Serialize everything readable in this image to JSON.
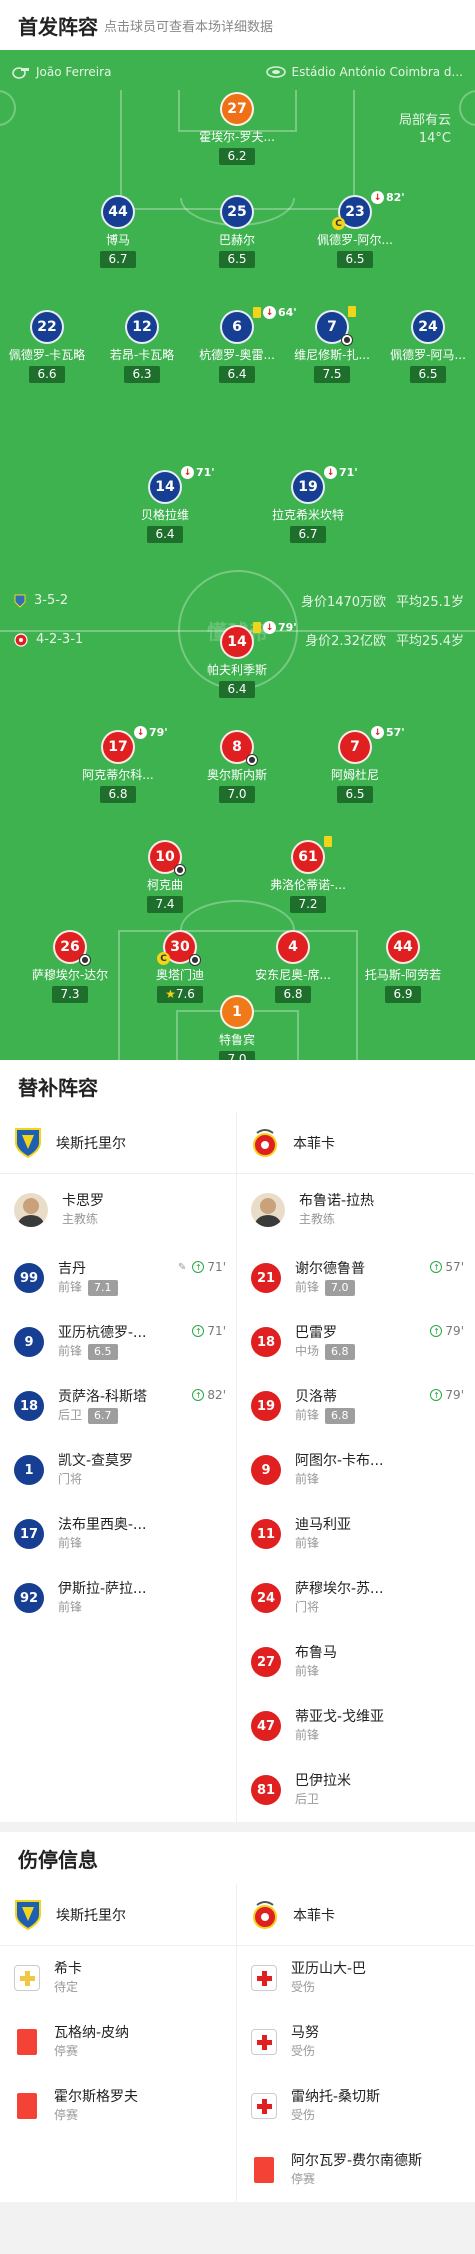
{
  "lineup_header": {
    "title": "首发阵容",
    "subtitle": "点击球员可查看本场详细数据"
  },
  "pitch": {
    "referee": "João Ferreira",
    "stadium": "Estádio António Coimbra d...",
    "weather": "局部有云",
    "temperature": "14°C",
    "watermark": "懂球帝",
    "away": {
      "formation": "3-5-2",
      "value": "身价1470万欧",
      "age": "平均25.1岁"
    },
    "home": {
      "formation": "4-2-3-1",
      "value": "身价2.32亿欧",
      "age": "平均25.4岁"
    }
  },
  "away_players": [
    {
      "num": "27",
      "name": "霍埃尔-罗夫...",
      "rating": "6.2"
    },
    {
      "num": "44",
      "name": "博马",
      "rating": "6.7"
    },
    {
      "num": "25",
      "name": "巴赫尔",
      "rating": "6.5"
    },
    {
      "num": "23",
      "name": "佩德罗-阿尔...",
      "rating": "6.5",
      "sub_min": "82'"
    },
    {
      "num": "22",
      "name": "佩德罗-卡瓦略",
      "rating": "6.6"
    },
    {
      "num": "12",
      "name": "若昂-卡瓦略",
      "rating": "6.3"
    },
    {
      "num": "6",
      "name": "杭德罗-奥雷...",
      "rating": "6.4",
      "sub_min": "64'"
    },
    {
      "num": "7",
      "name": "维尼修斯-扎...",
      "rating": "7.5"
    },
    {
      "num": "24",
      "name": "佩德罗-阿马...",
      "rating": "6.5"
    },
    {
      "num": "14",
      "name": "贝格拉维",
      "rating": "6.4",
      "sub_min": "71'"
    },
    {
      "num": "19",
      "name": "拉克希米坎特",
      "rating": "6.7",
      "sub_min": "71'"
    }
  ],
  "home_players": [
    {
      "num": "14",
      "name": "帕夫利季斯",
      "rating": "6.4",
      "sub_min": "79'"
    },
    {
      "num": "17",
      "name": "阿克蒂尔科...",
      "rating": "6.8",
      "sub_min": "79'"
    },
    {
      "num": "8",
      "name": "奥尔斯内斯",
      "rating": "7.0"
    },
    {
      "num": "7",
      "name": "阿姆杜尼",
      "rating": "6.5",
      "sub_min": "57'"
    },
    {
      "num": "10",
      "name": "柯克曲",
      "rating": "7.4"
    },
    {
      "num": "61",
      "name": "弗洛伦蒂诺-...",
      "rating": "7.2"
    },
    {
      "num": "26",
      "name": "萨穆埃尔-达尔",
      "rating": "7.3"
    },
    {
      "num": "30",
      "name": "奥塔门迪",
      "rating": "7.6"
    },
    {
      "num": "4",
      "name": "安东尼奥-席...",
      "rating": "6.8"
    },
    {
      "num": "44",
      "name": "托马斯-阿劳若",
      "rating": "6.9"
    },
    {
      "num": "1",
      "name": "特鲁宾",
      "rating": "7.0"
    }
  ],
  "subs_header": {
    "title": "替补阵容"
  },
  "subs": {
    "away_team": "埃斯托里尔",
    "home_team": "本菲卡",
    "away_coach": {
      "name": "卡思罗",
      "role": "主教练"
    },
    "home_coach": {
      "name": "布鲁诺-拉热",
      "role": "主教练"
    },
    "away": [
      {
        "num": "99",
        "name": "吉丹",
        "pos": "前锋",
        "rating": "7.1",
        "in": "71'"
      },
      {
        "num": "9",
        "name": "亚历杭德罗-...",
        "pos": "前锋",
        "rating": "6.5",
        "in": "71'"
      },
      {
        "num": "18",
        "name": "贡萨洛-科斯塔",
        "pos": "后卫",
        "rating": "6.7",
        "in": "82'"
      },
      {
        "num": "1",
        "name": "凯文-查莫罗",
        "pos": "门将"
      },
      {
        "num": "17",
        "name": "法布里西奥-...",
        "pos": "前锋"
      },
      {
        "num": "92",
        "name": "伊斯拉-萨拉...",
        "pos": "前锋"
      }
    ],
    "home": [
      {
        "num": "21",
        "name": "谢尔德鲁普",
        "pos": "前锋",
        "rating": "7.0",
        "in": "57'"
      },
      {
        "num": "18",
        "name": "巴雷罗",
        "pos": "中场",
        "rating": "6.8",
        "in": "79'"
      },
      {
        "num": "19",
        "name": "贝洛蒂",
        "pos": "前锋",
        "rating": "6.8",
        "in": "79'"
      },
      {
        "num": "9",
        "name": "阿图尔-卡布...",
        "pos": "前锋"
      },
      {
        "num": "11",
        "name": "迪马利亚",
        "pos": "前锋"
      },
      {
        "num": "24",
        "name": "萨穆埃尔-苏...",
        "pos": "门将"
      },
      {
        "num": "27",
        "name": "布鲁马",
        "pos": "前锋"
      },
      {
        "num": "47",
        "name": "蒂亚戈-戈维亚",
        "pos": "前锋"
      },
      {
        "num": "81",
        "name": "巴伊拉米",
        "pos": "后卫"
      }
    ]
  },
  "injury_header": {
    "title": "伤停信息"
  },
  "injuries": {
    "away_team": "埃斯托里尔",
    "home_team": "本菲卡",
    "away": [
      {
        "name": "希卡",
        "status": "待定"
      },
      {
        "name": "瓦格纳-皮纳",
        "status": "停赛"
      },
      {
        "name": "霍尔斯格罗夫",
        "status": "停赛"
      }
    ],
    "home": [
      {
        "name": "亚历山大-巴",
        "status": "受伤"
      },
      {
        "name": "马努",
        "status": "受伤"
      },
      {
        "name": "雷纳托-桑切斯",
        "status": "受伤"
      },
      {
        "name": "阿尔瓦罗-费尔南德斯",
        "status": "停赛"
      }
    ]
  },
  "colors": {
    "pitch": "#3db24e",
    "away": "#163f93",
    "home": "#e02020",
    "gk": "#f07018"
  }
}
